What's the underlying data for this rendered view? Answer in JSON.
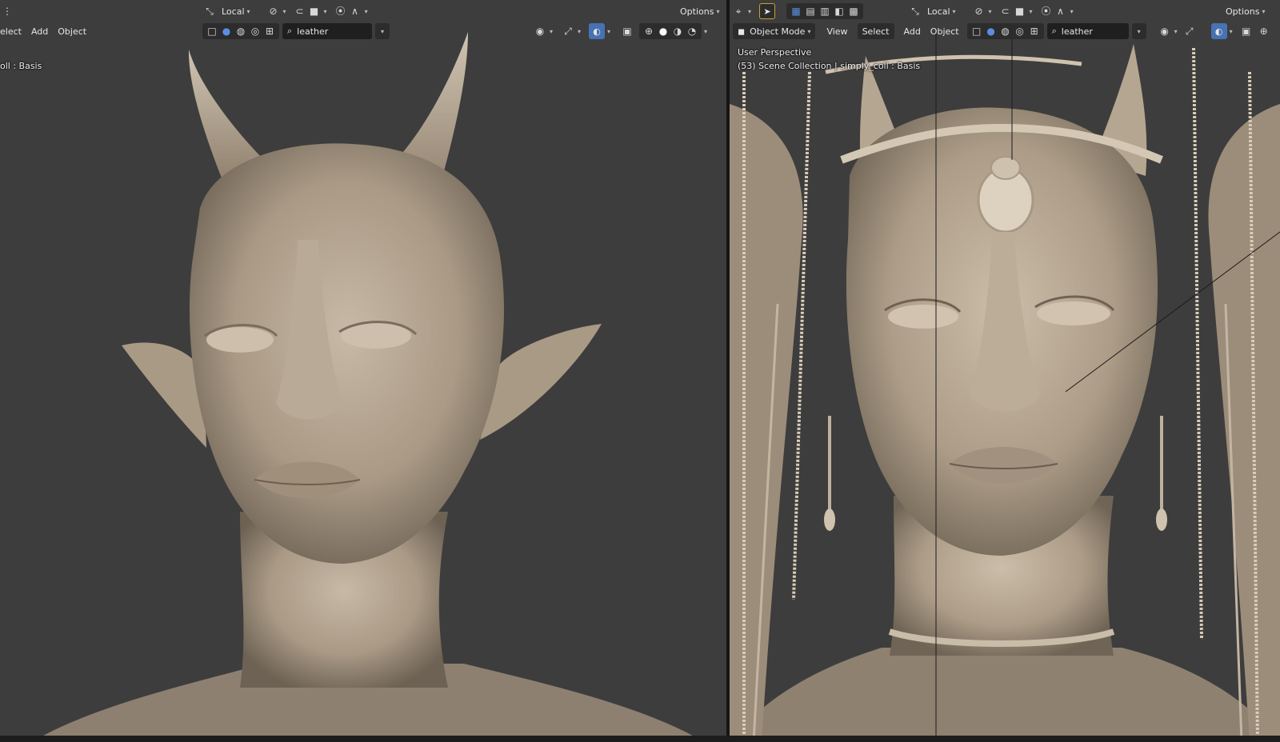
{
  "left_viewport": {
    "header_top": {
      "transform_orientation": "Local",
      "options_label": "Options"
    },
    "header_menu": {
      "select_label": "elect",
      "add_label": "Add",
      "object_label": "Object",
      "search_value": "leather"
    },
    "overlay_text": "oll : Basis"
  },
  "right_viewport": {
    "header_top": {
      "transform_orientation": "Local",
      "options_label": "Options"
    },
    "header_menu": {
      "mode_label": "Object Mode",
      "view_label": "View",
      "select_label": "Select",
      "add_label": "Add",
      "object_label": "Object",
      "search_value": "leather"
    },
    "overlay_line1": "User Perspective",
    "overlay_line2": "(53) Scene Collection | simply_coll : Basis"
  },
  "colors": {
    "viewport_bg": "#3d3d3d",
    "header_button": "#2c2c2c",
    "active_blue": "#4772b3",
    "clay": "#b4a694"
  }
}
